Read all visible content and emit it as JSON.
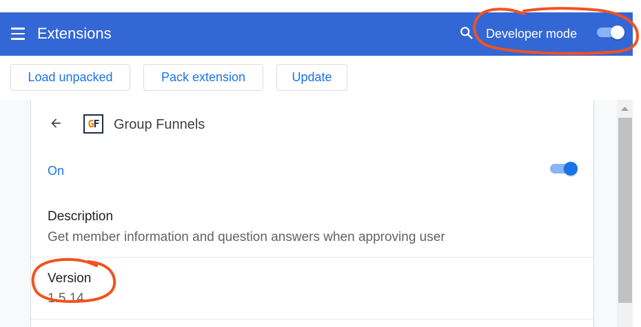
{
  "header": {
    "title": "Extensions",
    "menu_icon": "hamburger-menu-icon",
    "search_icon": "search-icon",
    "developer_mode_label": "Developer mode",
    "developer_mode_enabled": true,
    "background_color": "#3367d6"
  },
  "toolbar": {
    "load_unpacked": "Load unpacked",
    "pack_extension": "Pack extension",
    "update": "Update"
  },
  "extension": {
    "icon_letters": [
      "G",
      "F"
    ],
    "name": "Group Funnels",
    "status_label": "On",
    "enabled": true,
    "description_title": "Description",
    "description": "Get member information and question answers when approving user",
    "version_title": "Version",
    "version": "1.5.14"
  },
  "colors": {
    "accent": "#1a73e8",
    "annotation": "#f4511e"
  }
}
